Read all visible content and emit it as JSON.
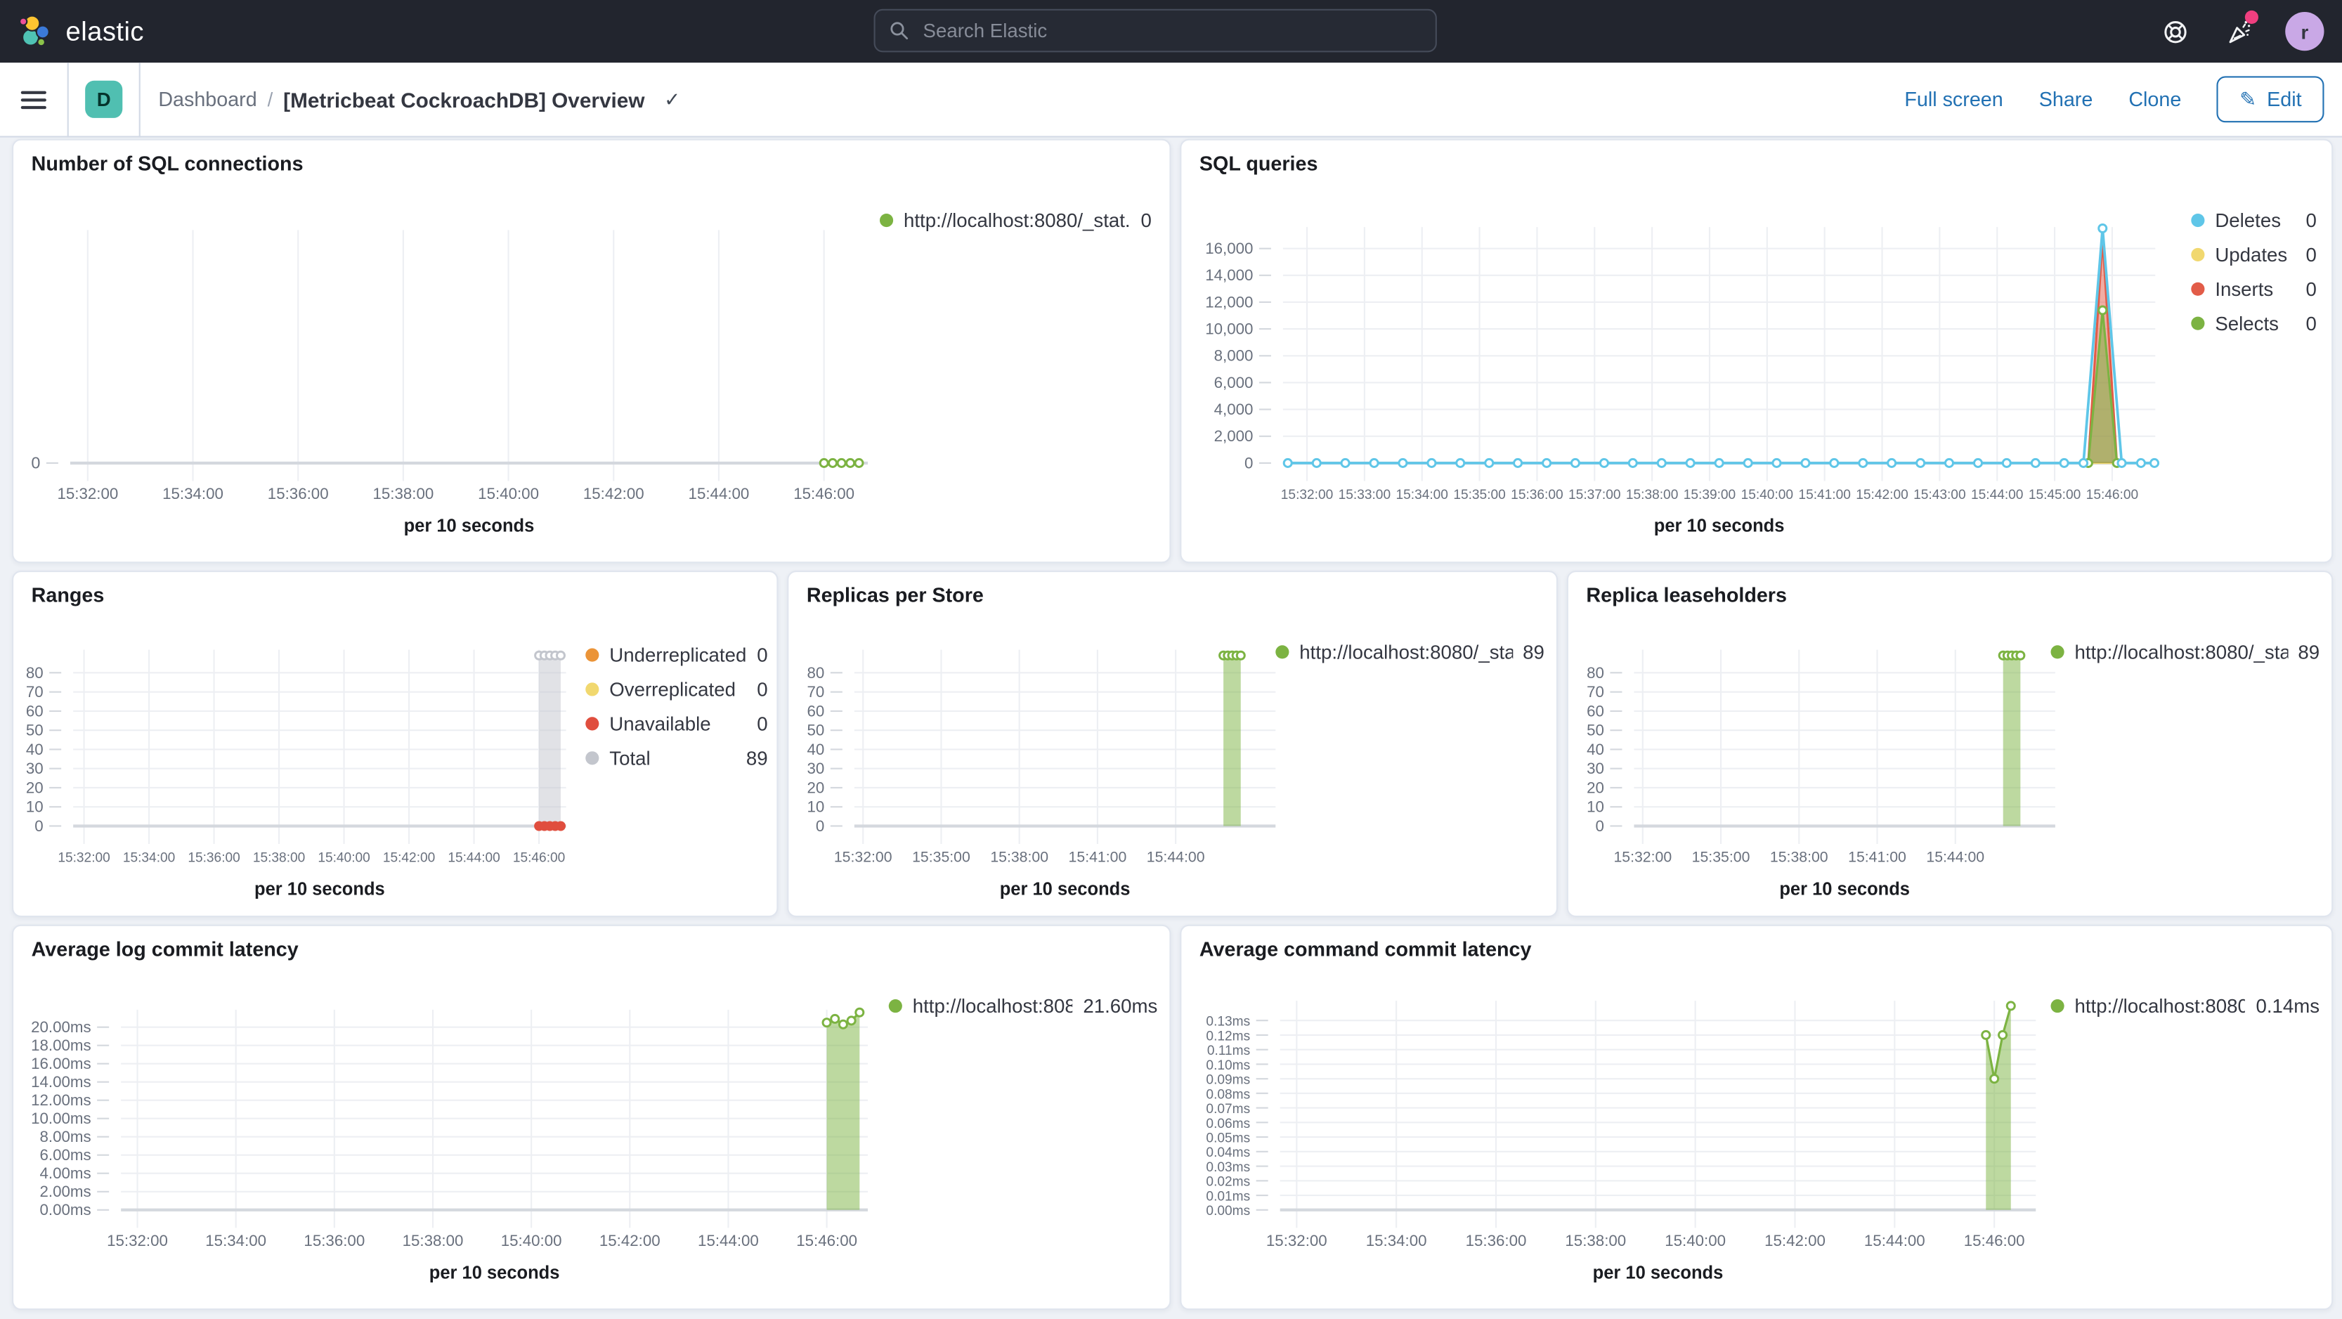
{
  "header": {
    "brand": "elastic",
    "search_placeholder": "Search Elastic",
    "avatar_initial": "r"
  },
  "toolbar": {
    "breadcrumb_root": "Dashboard",
    "breadcrumb_sep": "/",
    "title": "[Metricbeat CockroachDB] Overview",
    "check_glyph": "✓",
    "actions": {
      "full_screen": "Full screen",
      "share": "Share",
      "clone": "Clone",
      "edit": "Edit",
      "edit_icon_glyph": "✎"
    }
  },
  "chart_data": [
    {
      "type": "line",
      "title": "Number of SQL connections",
      "x": {
        "domain": [
          "15:31:40",
          "15:46:50"
        ],
        "ticks": [
          "15:32:00",
          "15:34:00",
          "15:36:00",
          "15:38:00",
          "15:40:00",
          "15:42:00",
          "15:44:00",
          "15:46:00"
        ],
        "unit_label": "per 10 seconds"
      },
      "y": {
        "max": 1,
        "ticks": [
          {
            "v": 0,
            "label": "0"
          }
        ]
      },
      "series": [
        {
          "name": "http://localhost:8080/_stat...",
          "color": "#7cb342",
          "width": 1.5,
          "markers": "open",
          "segments": [
            {
              "range": [
                "15:46:00",
                "15:46:40"
              ],
              "step": 10,
              "value": 0
            }
          ]
        }
      ],
      "legend": [
        {
          "label": "http://localhost:8080/_stat...",
          "value": "0",
          "color": "#7cb342"
        }
      ]
    },
    {
      "type": "area",
      "title": "SQL queries",
      "x": {
        "domain": [
          "15:31:35",
          "15:46:45"
        ],
        "ticks": [
          "15:32:00",
          "15:33:00",
          "15:34:00",
          "15:35:00",
          "15:36:00",
          "15:37:00",
          "15:38:00",
          "15:39:00",
          "15:40:00",
          "15:41:00",
          "15:42:00",
          "15:43:00",
          "15:44:00",
          "15:45:00",
          "15:46:00"
        ],
        "unit_label": "per 10 seconds"
      },
      "y": {
        "max": 17600,
        "ticks": [
          {
            "v": 16000,
            "label": "16,000"
          },
          {
            "v": 14000,
            "label": "14,000"
          },
          {
            "v": 12000,
            "label": "12,000"
          },
          {
            "v": 10000,
            "label": "10,000"
          },
          {
            "v": 8000,
            "label": "8,000"
          },
          {
            "v": 6000,
            "label": "6,000"
          },
          {
            "v": 4000,
            "label": "4,000"
          },
          {
            "v": 2000,
            "label": "2,000"
          },
          {
            "v": 0,
            "label": "0"
          }
        ]
      },
      "series": [
        {
          "name": "Updates",
          "color": "#f1d86f",
          "width": 1.2,
          "markers": "none",
          "segments": [
            {
              "range": [
                "15:31:40",
                "15:46:40"
              ],
              "step": 60,
              "value": 0
            }
          ]
        },
        {
          "name": "Inserts",
          "color": "#e25c48",
          "width": 1.5,
          "fill": true,
          "fill_opacity": 0.5,
          "markers": "none",
          "segments": [
            {
              "points": [
                [
                  "15:45:35",
                  0
                ],
                [
                  "15:45:50",
                  16700
                ],
                [
                  "15:46:05",
                  0
                ]
              ]
            }
          ]
        },
        {
          "name": "Selects",
          "color": "#7cb342",
          "width": 1.5,
          "fill": true,
          "fill_opacity": 0.55,
          "markers": "open",
          "segments": [
            {
              "points": [
                [
                  "15:45:35",
                  0
                ],
                [
                  "15:45:50",
                  11400
                ],
                [
                  "15:46:05",
                  0
                ]
              ]
            }
          ]
        },
        {
          "name": "Deletes",
          "color": "#5fc6e8",
          "width": 1.75,
          "markers": "open",
          "segments": [
            {
              "range": [
                "15:31:40",
                "15:45:10"
              ],
              "step": 30,
              "value": 0
            },
            {
              "points": [
                [
                  "15:45:30",
                  0
                ],
                [
                  "15:45:50",
                  17500
                ],
                [
                  "15:46:10",
                  0
                ],
                [
                  "15:46:30",
                  0
                ],
                [
                  "15:46:44",
                  0
                ]
              ]
            }
          ]
        }
      ],
      "legend": [
        {
          "label": "Deletes",
          "value": "0",
          "color": "#5fc6e8"
        },
        {
          "label": "Updates",
          "value": "0",
          "color": "#f1d86f"
        },
        {
          "label": "Inserts",
          "value": "0",
          "color": "#e25c48"
        },
        {
          "label": "Selects",
          "value": "0",
          "color": "#7cb342"
        }
      ]
    },
    {
      "type": "area",
      "title": "Ranges",
      "x": {
        "domain": [
          "15:31:40",
          "15:46:50"
        ],
        "ticks": [
          "15:32:00",
          "15:34:00",
          "15:36:00",
          "15:38:00",
          "15:40:00",
          "15:42:00",
          "15:44:00",
          "15:46:00"
        ],
        "unit_label": "per 10 seconds"
      },
      "y": {
        "max": 92,
        "ticks": [
          {
            "v": 80,
            "label": "80"
          },
          {
            "v": 70,
            "label": "70"
          },
          {
            "v": 60,
            "label": "60"
          },
          {
            "v": 50,
            "label": "50"
          },
          {
            "v": 40,
            "label": "40"
          },
          {
            "v": 30,
            "label": "30"
          },
          {
            "v": 20,
            "label": "20"
          },
          {
            "v": 10,
            "label": "10"
          },
          {
            "v": 0,
            "label": "0"
          }
        ]
      },
      "series": [
        {
          "name": "Total",
          "color": "#c3c6cd",
          "width": 1.5,
          "fill": true,
          "fill_opacity": 0.5,
          "markers": "open",
          "segments": [
            {
              "range": [
                "15:46:00",
                "15:46:40"
              ],
              "step": 10,
              "value": 89
            }
          ]
        },
        {
          "name": "Unavailable",
          "color": "#e04e3e",
          "width": 1.75,
          "markers": "solid",
          "segments": [
            {
              "range": [
                "15:46:00",
                "15:46:40"
              ],
              "step": 10,
              "value": 0
            }
          ]
        }
      ],
      "legend": [
        {
          "label": "Underreplicated",
          "value": "0",
          "color": "#eb9438"
        },
        {
          "label": "Overreplicated",
          "value": "0",
          "color": "#f1d86f"
        },
        {
          "label": "Unavailable",
          "value": "0",
          "color": "#e04e3e"
        },
        {
          "label": "Total",
          "value": "89",
          "color": "#c3c6cd"
        }
      ]
    },
    {
      "type": "area",
      "title": "Replicas per Store",
      "x": {
        "domain": [
          "15:31:40",
          "15:47:50"
        ],
        "ticks": [
          "15:32:00",
          "15:35:00",
          "15:38:00",
          "15:41:00",
          "15:44:00"
        ],
        "unit_label": "per 10 seconds"
      },
      "y": {
        "max": 92,
        "ticks": [
          {
            "v": 80,
            "label": "80"
          },
          {
            "v": 70,
            "label": "70"
          },
          {
            "v": 60,
            "label": "60"
          },
          {
            "v": 50,
            "label": "50"
          },
          {
            "v": 40,
            "label": "40"
          },
          {
            "v": 30,
            "label": "30"
          },
          {
            "v": 20,
            "label": "20"
          },
          {
            "v": 10,
            "label": "10"
          },
          {
            "v": 0,
            "label": "0"
          }
        ]
      },
      "series": [
        {
          "name": "http://localhost:8080/_sta...",
          "color": "#7cb342",
          "width": 1.5,
          "fill": true,
          "fill_opacity": 0.5,
          "markers": "open",
          "segments": [
            {
              "range": [
                "15:45:50",
                "15:46:30"
              ],
              "step": 10,
              "value": 89
            }
          ]
        }
      ],
      "legend": [
        {
          "label": "http://localhost:8080/_sta...",
          "value": "89",
          "color": "#7cb342"
        }
      ]
    },
    {
      "type": "area",
      "title": "Replica leaseholders",
      "x": {
        "domain": [
          "15:31:40",
          "15:47:50"
        ],
        "ticks": [
          "15:32:00",
          "15:35:00",
          "15:38:00",
          "15:41:00",
          "15:44:00"
        ],
        "unit_label": "per 10 seconds"
      },
      "y": {
        "max": 92,
        "ticks": [
          {
            "v": 80,
            "label": "80"
          },
          {
            "v": 70,
            "label": "70"
          },
          {
            "v": 60,
            "label": "60"
          },
          {
            "v": 50,
            "label": "50"
          },
          {
            "v": 40,
            "label": "40"
          },
          {
            "v": 30,
            "label": "30"
          },
          {
            "v": 20,
            "label": "20"
          },
          {
            "v": 10,
            "label": "10"
          },
          {
            "v": 0,
            "label": "0"
          }
        ]
      },
      "series": [
        {
          "name": "http://localhost:8080/_sta...",
          "color": "#7cb342",
          "width": 1.5,
          "fill": true,
          "fill_opacity": 0.5,
          "markers": "open",
          "segments": [
            {
              "range": [
                "15:45:50",
                "15:46:30"
              ],
              "step": 10,
              "value": 89
            }
          ]
        }
      ],
      "legend": [
        {
          "label": "http://localhost:8080/_sta...",
          "value": "89",
          "color": "#7cb342"
        }
      ]
    },
    {
      "type": "area",
      "title": "Average log commit latency",
      "x": {
        "domain": [
          "15:31:40",
          "15:46:50"
        ],
        "ticks": [
          "15:32:00",
          "15:34:00",
          "15:36:00",
          "15:38:00",
          "15:40:00",
          "15:42:00",
          "15:44:00",
          "15:46:00"
        ],
        "unit_label": "per 10 seconds"
      },
      "y": {
        "max": 21.9,
        "ticks": [
          {
            "v": 20,
            "label": "20.00ms"
          },
          {
            "v": 18,
            "label": "18.00ms"
          },
          {
            "v": 16,
            "label": "16.00ms"
          },
          {
            "v": 14,
            "label": "14.00ms"
          },
          {
            "v": 12,
            "label": "12.00ms"
          },
          {
            "v": 10,
            "label": "10.00ms"
          },
          {
            "v": 8,
            "label": "8.00ms"
          },
          {
            "v": 6,
            "label": "6.00ms"
          },
          {
            "v": 4,
            "label": "4.00ms"
          },
          {
            "v": 2,
            "label": "2.00ms"
          },
          {
            "v": 0,
            "label": "0.00ms"
          }
        ]
      },
      "series": [
        {
          "name": "http://localhost:808...",
          "color": "#7cb342",
          "width": 1.5,
          "fill": true,
          "fill_opacity": 0.5,
          "markers": "open",
          "segments": [
            {
              "points": [
                [
                  "15:46:00",
                  20.5
                ],
                [
                  "15:46:10",
                  20.9
                ],
                [
                  "15:46:20",
                  20.3
                ],
                [
                  "15:46:30",
                  20.7
                ],
                [
                  "15:46:40",
                  21.6
                ]
              ]
            }
          ]
        }
      ],
      "legend": [
        {
          "label": "http://localhost:808...",
          "value": "21.60ms",
          "color": "#7cb342"
        }
      ]
    },
    {
      "type": "area",
      "title": "Average command commit latency",
      "x": {
        "domain": [
          "15:31:40",
          "15:46:50"
        ],
        "ticks": [
          "15:32:00",
          "15:34:00",
          "15:36:00",
          "15:38:00",
          "15:40:00",
          "15:42:00",
          "15:44:00",
          "15:46:00"
        ],
        "unit_label": "per 10 seconds"
      },
      "y": {
        "max": 0.1435,
        "ticks": [
          {
            "v": 0.13,
            "label": "0.13ms"
          },
          {
            "v": 0.12,
            "label": "0.12ms"
          },
          {
            "v": 0.11,
            "label": "0.11ms"
          },
          {
            "v": 0.1,
            "label": "0.10ms"
          },
          {
            "v": 0.09,
            "label": "0.09ms"
          },
          {
            "v": 0.08,
            "label": "0.08ms"
          },
          {
            "v": 0.07,
            "label": "0.07ms"
          },
          {
            "v": 0.06,
            "label": "0.06ms"
          },
          {
            "v": 0.05,
            "label": "0.05ms"
          },
          {
            "v": 0.04,
            "label": "0.04ms"
          },
          {
            "v": 0.03,
            "label": "0.03ms"
          },
          {
            "v": 0.02,
            "label": "0.02ms"
          },
          {
            "v": 0.01,
            "label": "0.01ms"
          },
          {
            "v": 0,
            "label": "0.00ms"
          }
        ]
      },
      "series": [
        {
          "name": "http://localhost:8080...",
          "color": "#7cb342",
          "width": 1.5,
          "fill": true,
          "fill_opacity": 0.5,
          "markers": "open",
          "segments": [
            {
              "points": [
                [
                  "15:45:50",
                  0.12
                ],
                [
                  "15:46:00",
                  0.09
                ],
                [
                  "15:46:10",
                  0.12
                ],
                [
                  "15:46:20",
                  0.14
                ]
              ]
            }
          ]
        }
      ],
      "legend": [
        {
          "label": "http://localhost:8080...",
          "value": "0.14ms",
          "color": "#7cb342"
        }
      ]
    }
  ]
}
